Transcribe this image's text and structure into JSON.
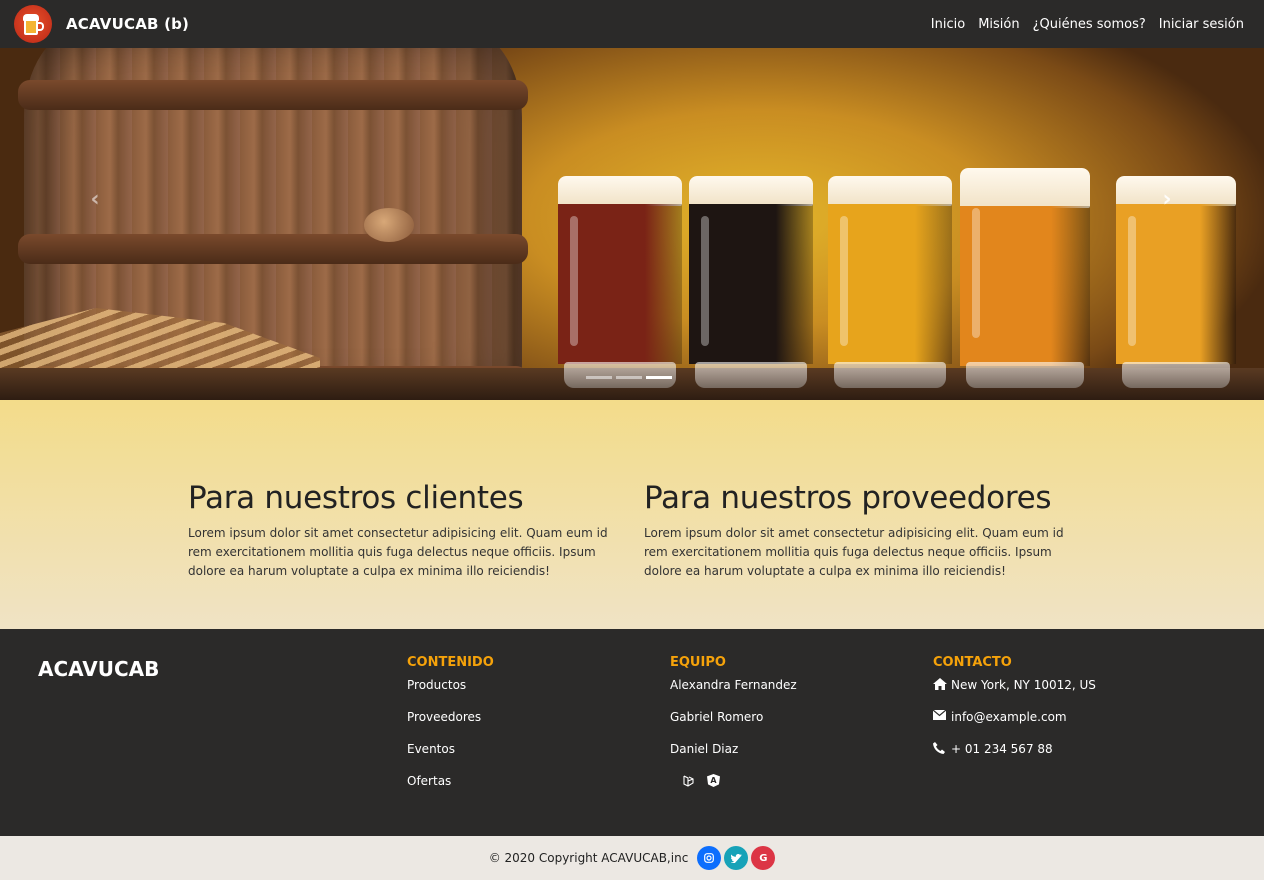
{
  "navbar": {
    "brand": "ACAVUCAB (b)",
    "links": [
      "Inicio",
      "Misión",
      "¿Quiénes somos?",
      "Iniciar sesión"
    ]
  },
  "carousel": {
    "prev_glyph": "‹",
    "next_glyph": "›",
    "beer_colors": [
      "#7a2316",
      "#1e1512",
      "#e7a41c",
      "#e2861c",
      "#e9a024"
    ],
    "slide_count": 3
  },
  "features": [
    {
      "title": "Para nuestros clientes",
      "text": "Lorem ipsum dolor sit amet consectetur adipisicing elit. Quam eum id rem exercitationem mollitia quis fuga delectus neque officiis. Ipsum dolore ea harum voluptate a culpa ex minima illo reiciendis!"
    },
    {
      "title": "Para nuestros proveedores",
      "text": "Lorem ipsum dolor sit amet consectetur adipisicing elit. Quam eum id rem exercitationem mollitia quis fuga delectus neque officiis. Ipsum dolore ea harum voluptate a culpa ex minima illo reiciendis!"
    }
  ],
  "footer": {
    "brand": "ACAVUCAB",
    "contenido": {
      "heading": "CONTENIDO",
      "items": [
        "Productos",
        "Proveedores",
        "Eventos",
        "Ofertas"
      ]
    },
    "equipo": {
      "heading": "EQUIPO",
      "items": [
        "Alexandra Fernandez",
        "Gabriel Romero",
        "Daniel Diaz"
      ],
      "tech_icons": [
        "laravel-icon",
        "angular-icon"
      ]
    },
    "contacto": {
      "heading": "CONTACTO",
      "address": "New York, NY 10012, US",
      "email": "info@example.com",
      "phone": "+ 01 234 567 88"
    }
  },
  "bottombar": {
    "copyright": "© 2020 Copyright ACAVUCAB,inc",
    "social": [
      {
        "icon": "instagram-icon",
        "color": "#0d6efd",
        "glyph": "◎"
      },
      {
        "icon": "twitter-icon",
        "color": "#17a2b8",
        "glyph": "🐦"
      },
      {
        "icon": "google-icon",
        "color": "#dc3545",
        "glyph": "G"
      }
    ]
  }
}
